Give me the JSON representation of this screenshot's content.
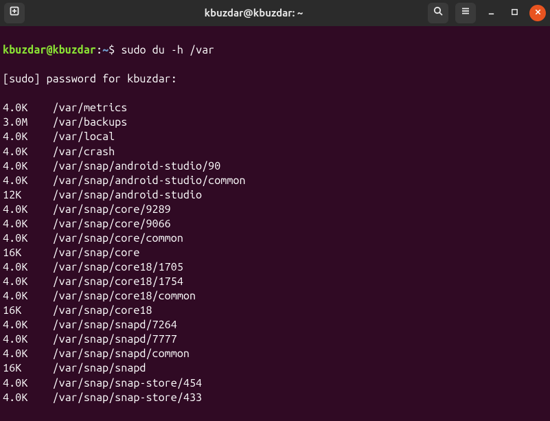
{
  "window": {
    "title": "kbuzdar@kbuzdar: ~"
  },
  "prompt": {
    "user": "kbuzdar",
    "at": "@",
    "host": "kbuzdar",
    "colon": ":",
    "path": "~",
    "dollar": "$",
    "command": " sudo du -h /var"
  },
  "sudo_line": "[sudo] password for kbuzdar:",
  "rows": [
    {
      "size": "4.0K",
      "path": "/var/metrics"
    },
    {
      "size": "3.0M",
      "path": "/var/backups"
    },
    {
      "size": "4.0K",
      "path": "/var/local"
    },
    {
      "size": "4.0K",
      "path": "/var/crash"
    },
    {
      "size": "4.0K",
      "path": "/var/snap/android-studio/90"
    },
    {
      "size": "4.0K",
      "path": "/var/snap/android-studio/common"
    },
    {
      "size": "12K",
      "path": "/var/snap/android-studio"
    },
    {
      "size": "4.0K",
      "path": "/var/snap/core/9289"
    },
    {
      "size": "4.0K",
      "path": "/var/snap/core/9066"
    },
    {
      "size": "4.0K",
      "path": "/var/snap/core/common"
    },
    {
      "size": "16K",
      "path": "/var/snap/core"
    },
    {
      "size": "4.0K",
      "path": "/var/snap/core18/1705"
    },
    {
      "size": "4.0K",
      "path": "/var/snap/core18/1754"
    },
    {
      "size": "4.0K",
      "path": "/var/snap/core18/common"
    },
    {
      "size": "16K",
      "path": "/var/snap/core18"
    },
    {
      "size": "4.0K",
      "path": "/var/snap/snapd/7264"
    },
    {
      "size": "4.0K",
      "path": "/var/snap/snapd/7777"
    },
    {
      "size": "4.0K",
      "path": "/var/snap/snapd/common"
    },
    {
      "size": "16K",
      "path": "/var/snap/snapd"
    },
    {
      "size": "4.0K",
      "path": "/var/snap/snap-store/454"
    },
    {
      "size": "4.0K",
      "path": "/var/snap/snap-store/433"
    }
  ]
}
